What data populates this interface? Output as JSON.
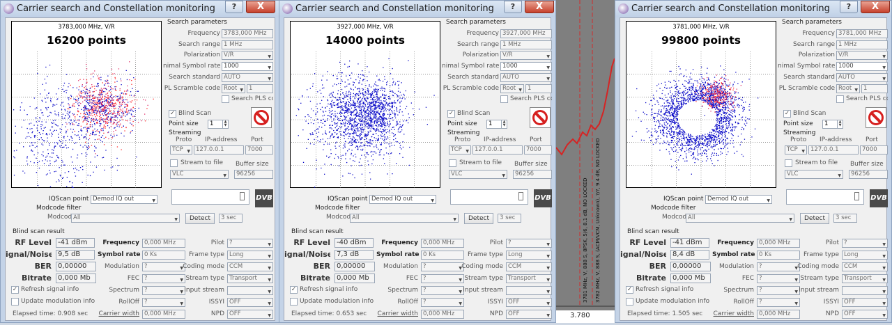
{
  "common": {
    "title": "Carrier search and Constellation monitoring",
    "help_label": "?",
    "close_label": "X",
    "search_parameters": "Search parameters",
    "labels": {
      "frequency": "Frequency",
      "search_range": "Search range",
      "polarization": "Polarization",
      "min_symbol_rate": "nimal Symbol rate",
      "search_standard": "Search standard",
      "pl_scramble": "PL Scramble code"
    },
    "search_range": "1 MHz",
    "polarization": "V/R",
    "min_symbol_rate": "1000",
    "search_standard": "AUTO",
    "pl_scramble_type": "Root",
    "pl_scramble_value": "1",
    "search_pls": "Search PLS cc",
    "blind_scan": "Blind Scan",
    "point_size_label": "Point size",
    "point_size": "1",
    "streaming": "Streaming",
    "proto_label": "Proto",
    "ip_label": "IP-address",
    "port_label": "Port",
    "proto": "TCP",
    "ip": "127.0.0.1",
    "port": "7000",
    "stream_to_file": "Stream to file",
    "buffer_size_label": "Buffer size",
    "player": "VLC",
    "buffer_size": "96256",
    "iqscan_label": "IQScan point",
    "iqscan_value": "Demod IQ out",
    "dvb_logo": "DVB",
    "modcode_filter": "Modcode filter",
    "modcod_label": "Modcod",
    "modcod_value": "All",
    "detect": "Detect",
    "detect_time": "3 sec",
    "blind_scan_result": "Blind scan result",
    "res_labels": {
      "rf_level": "RF Level",
      "snr": "ignal/Noise",
      "ber": "BER",
      "bitrate": "Bitrate",
      "frequency": "Frequency",
      "symbol_rate": "Symbol rate",
      "modulation": "Modulation",
      "fec": "FEC",
      "spectrum": "Spectrum",
      "rolloff": "RollOff",
      "carrier_width": "Carrier width",
      "pilot": "Pilot",
      "frame_type": "Frame type",
      "coding_mode": "Coding mode",
      "stream_type": "Stream type",
      "input_stream": "Input stream",
      "issyi": "ISSYI",
      "npd": "NPD"
    },
    "res_values": {
      "ber": "0,00000",
      "bitrate": "0,000 Mb",
      "frequency": "0,000 MHz",
      "symbol_rate": "0 Ks",
      "modulation": "?",
      "fec": "?",
      "spectrum": "?",
      "rolloff": "?",
      "carrier_width": "0,000 MHz",
      "pilot": "?",
      "frame_type": "Long",
      "coding_mode": "CCM",
      "stream_type": "Transport",
      "input_stream": "",
      "issyi": "OFF",
      "npd": "OFF"
    },
    "refresh_signal_info": "Refresh signal info",
    "update_modulation_info": "Update modulation info"
  },
  "windows": [
    {
      "freq_header": "3783,000 MHz, V/R",
      "points": "16200 points",
      "frequency": "3783,000 MHz",
      "rf_level": "-41 dBm",
      "snr": "9,5 dB",
      "elapsed": "Elapsed time: 0.908 sec"
    },
    {
      "freq_header": "3927,000 MHz, V/R",
      "points": "14000 points",
      "frequency": "3927,000 MHz",
      "rf_level": "-40 dBm",
      "snr": "7,3 dB",
      "elapsed": "Elapsed time: 0.653 sec"
    },
    {
      "freq_header": "3781,000 MHz, V/R",
      "points": "99800 points",
      "frequency": "3781,000 MHz",
      "rf_level": "-41 dBm",
      "snr": "8,4 dB",
      "elapsed": "Elapsed time: 1.505 sec"
    }
  ],
  "spectrum_strip": {
    "marker_1": "3781 MHz, V, 888 S, 8PSK, 5/6, 8.1 dB, NO LOCKED",
    "marker_2": "3782 MHz, V, 888 S, (ACM/VCM, Unknown), ?/?, 9.4 dB, NO LOCKED",
    "axis_label": "3.780"
  },
  "colors": {
    "accent_red": "#d6201f",
    "scope_blue": "#0a0ac8",
    "titlebar": "#c9d8ec"
  }
}
